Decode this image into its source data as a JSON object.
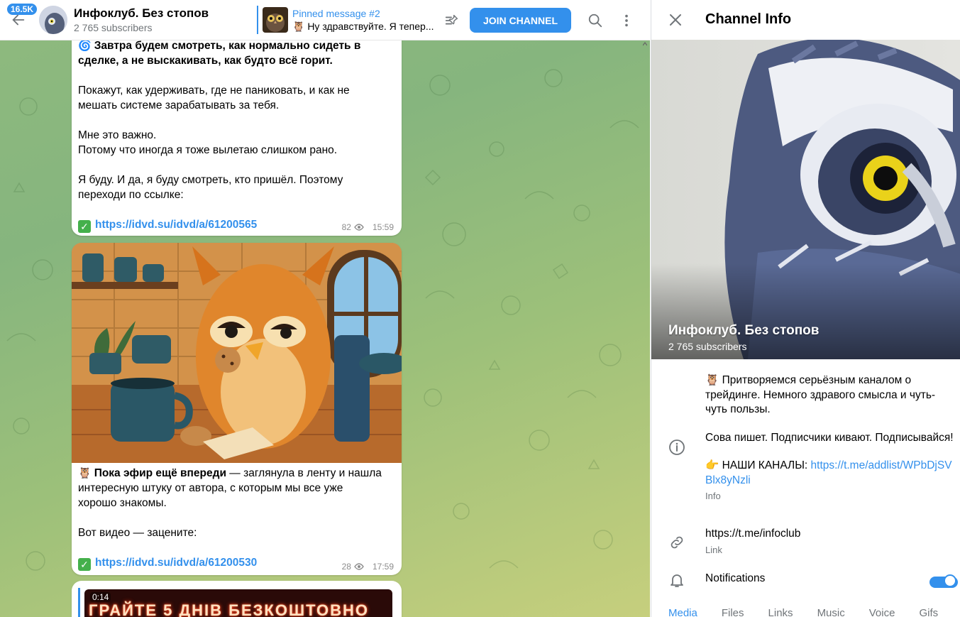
{
  "header": {
    "badge": "16.5K",
    "title": "Инфоклуб. Без стопов",
    "subscribers": "2 765 subscribers",
    "pinned_title": "Pinned message #2",
    "pinned_text": "🦉 Ну здравствуйте. Я тепер...",
    "join_label": "JOIN CHANNEL"
  },
  "messages": [
    {
      "lines_bold": [
        "Завтра будем смотреть, как нормально сидеть в",
        "сделке, а не выскакивать, как будто всё горит."
      ],
      "para1": [
        "Покажут, как удерживать, где не паниковать, и как не",
        "мешать системе зарабатывать за тебя."
      ],
      "para2": [
        "Мне это важно.",
        "Потому что иногда я тоже вылетаю слишком рано."
      ],
      "para3": [
        "Я буду. И да, я буду смотреть, кто пришёл. Поэтому",
        "переходи по ссылке:"
      ],
      "link": "https://idvd.su/idvd/a/61200565",
      "views": "82",
      "time": "15:59"
    },
    {
      "bold_lead": "Пока эфир ещё впереди",
      "line1_rest": " — заглянула в ленту и нашла",
      "line2": "интересную штуку от автора, с которым мы все уже",
      "line3": "хорошо знакомы.",
      "line4": "Вот видео — зацените:",
      "link": "https://idvd.su/idvd/a/61200530",
      "views": "28",
      "time": "17:59"
    },
    {
      "duration": "0:14",
      "banner": "ГРАЙТЕ 5 ДНІВ БЕЗКОШТОВНО"
    }
  ],
  "info": {
    "title": "Channel Info",
    "name": "Инфоклуб. Без стопов",
    "subscribers": "2 765 subscribers",
    "about_1": "🦉 Притворяемся серьёзным каналом о трейдинге. Немного здравого смысла и чуть-чуть пользы.",
    "about_2": "Сова пишет. Подписчики кивают. Подписывайся!",
    "about_3_prefix": "👉 НАШИ КАНАЛЫ: ",
    "about_3_link": "https://t.me/addlist/WPbDjSVBlx8yNzli",
    "info_label": "Info",
    "link": "https://t.me/infoclub",
    "link_label": "Link",
    "notifications": "Notifications",
    "tabs": [
      "Media",
      "Files",
      "Links",
      "Music",
      "Voice",
      "Gifs"
    ]
  },
  "colors": {
    "accent": "#3390ec",
    "check_green": "#44b04b"
  },
  "icons": [
    "back-arrow-icon",
    "pin-list-icon",
    "search-icon",
    "more-vertical-icon",
    "close-icon",
    "info-icon",
    "link-icon",
    "bell-icon",
    "eye-icon",
    "check-mark-icon"
  ]
}
